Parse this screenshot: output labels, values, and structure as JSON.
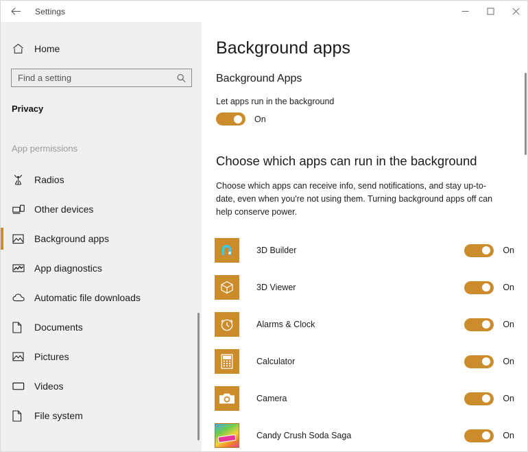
{
  "window": {
    "title": "Settings",
    "back_icon": "back-arrow-icon",
    "minimize_label": "Minimize",
    "maximize_label": "Maximize",
    "close_label": "Close"
  },
  "sidebar": {
    "home": {
      "label": "Home",
      "icon": "home-icon"
    },
    "search": {
      "value": "",
      "placeholder": "Find a setting",
      "icon": "search-icon"
    },
    "section_title": "Privacy",
    "group_label": "App permissions",
    "items": [
      {
        "label": "Radios",
        "icon": "radio-tower-icon",
        "selected": false
      },
      {
        "label": "Other devices",
        "icon": "devices-icon",
        "selected": false
      },
      {
        "label": "Background apps",
        "icon": "picture-frame-icon",
        "selected": true
      },
      {
        "label": "App diagnostics",
        "icon": "diagnostics-icon",
        "selected": false
      },
      {
        "label": "Automatic file downloads",
        "icon": "cloud-icon",
        "selected": false
      },
      {
        "label": "Documents",
        "icon": "document-icon",
        "selected": false
      },
      {
        "label": "Pictures",
        "icon": "picture-icon",
        "selected": false
      },
      {
        "label": "Videos",
        "icon": "video-icon",
        "selected": false
      },
      {
        "label": "File system",
        "icon": "document-icon",
        "selected": false
      }
    ]
  },
  "main": {
    "page_title": "Background apps",
    "section_heading": "Background Apps",
    "master_toggle": {
      "label": "Let apps run in the background",
      "state": "On"
    },
    "choose_heading": "Choose which apps can run in the background",
    "choose_description": "Choose which apps can receive info, send notifications, and stay up-to-date, even when you're not using them. Turning background apps off can help conserve power.",
    "apps": [
      {
        "name": "3D Builder",
        "icon": "3d-builder-icon",
        "state": "On"
      },
      {
        "name": "3D Viewer",
        "icon": "3d-viewer-icon",
        "state": "On"
      },
      {
        "name": "Alarms & Clock",
        "icon": "alarm-clock-icon",
        "state": "On"
      },
      {
        "name": "Calculator",
        "icon": "calculator-icon",
        "state": "On"
      },
      {
        "name": "Camera",
        "icon": "camera-icon",
        "state": "On"
      },
      {
        "name": "Candy Crush Soda Saga",
        "icon": "candy-crush-icon",
        "state": "On"
      }
    ]
  },
  "colors": {
    "accent": "#cd8c2b",
    "sidebar_bg": "#f0f0f0",
    "content_bg": "#ffffff",
    "text": "#1b1b1b",
    "muted_text": "#9b9b9b"
  }
}
